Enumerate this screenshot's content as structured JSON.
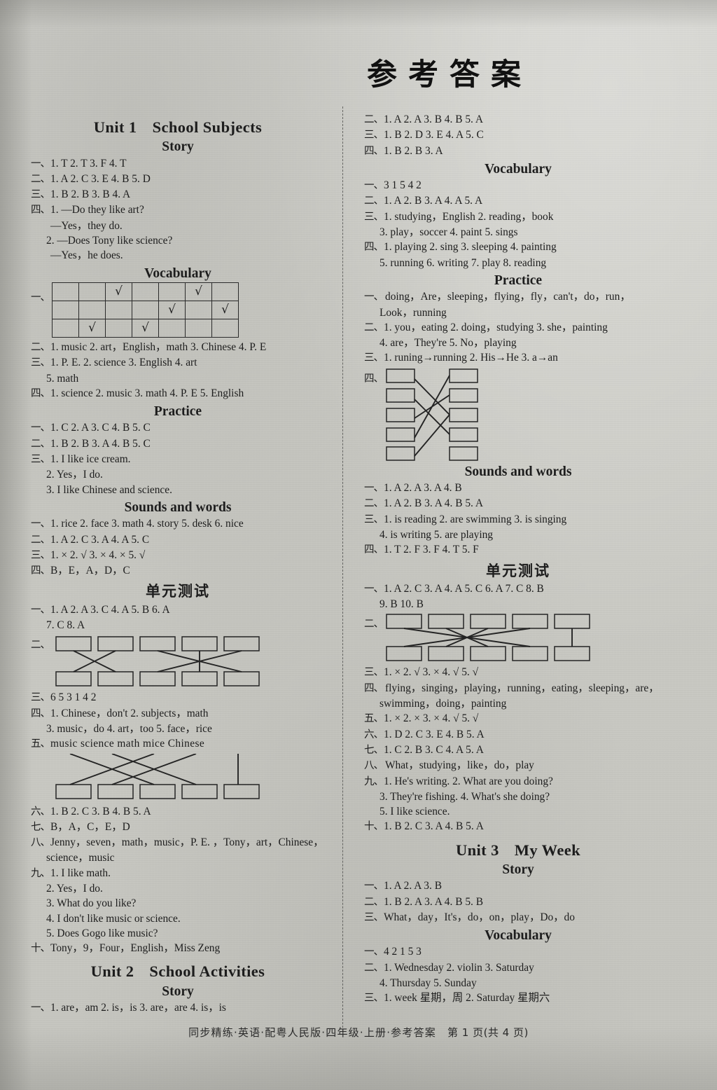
{
  "document": {
    "title": "参考答案",
    "footer": "同步精练·英语·配粤人民版·四年级·上册·参考答案",
    "page_label": "第 1 页(共 4 页)"
  },
  "left_column": {
    "unit1": {
      "number": "Unit 1",
      "name": "School Subjects",
      "story": {
        "heading": "Story",
        "lines": [
          {
            "marker": "一、",
            "text": "1. T  2. T  3. F  4. T"
          },
          {
            "marker": "二、",
            "text": "1. A  2. C  3. E  4. B  5. D"
          },
          {
            "marker": "三、",
            "text": "1. B  2. B  3. B  4. A"
          },
          {
            "marker": "四、",
            "text": "1. —Do they like art?"
          },
          {
            "marker": "",
            "text": "—Yes，they do."
          },
          {
            "marker": "",
            "text": "2. —Does Tony like science?"
          },
          {
            "marker": "",
            "text": "—Yes，he does."
          }
        ]
      },
      "vocabulary": {
        "heading": "Vocabulary",
        "grid_marker": "一、",
        "grid": [
          [
            "",
            "",
            "√",
            "",
            "",
            "√",
            ""
          ],
          [
            "",
            "",
            "",
            "",
            "√",
            "",
            "√"
          ],
          [
            "",
            "√",
            "",
            "√",
            "",
            "",
            ""
          ]
        ],
        "lines": [
          {
            "marker": "二、",
            "text": "1. music  2. art，English，math  3. Chinese  4. P. E"
          },
          {
            "marker": "三、",
            "text": "1. P. E.  2. science  3. English  4. art"
          },
          {
            "marker": "",
            "text": "5. math"
          },
          {
            "marker": "四、",
            "text": "1. science  2. music  3. math  4. P. E  5. English"
          }
        ]
      },
      "practice": {
        "heading": "Practice",
        "lines": [
          {
            "marker": "一、",
            "text": "1. C  2. A  3. C  4. B  5. C"
          },
          {
            "marker": "二、",
            "text": "1. B  2. B  3. A  4. B  5. C"
          },
          {
            "marker": "三、",
            "text": "1. I like ice cream."
          },
          {
            "marker": "",
            "text": "2. Yes，I do."
          },
          {
            "marker": "",
            "text": "3. I like Chinese and science."
          }
        ]
      },
      "sounds": {
        "heading": "Sounds and words",
        "lines": [
          {
            "marker": "一、",
            "text": "1. rice  2. face  3. math  4. story  5. desk  6. nice"
          },
          {
            "marker": "二、",
            "text": "1. A  2. C  3. A  4. A  5. C"
          },
          {
            "marker": "三、",
            "text": "1. ×  2. √  3. ×  4. ×  5. √"
          },
          {
            "marker": "四、",
            "text": "B，E，A，D，C"
          }
        ]
      },
      "unit_test": {
        "heading": "单元测试",
        "lines_before": [
          {
            "marker": "一、",
            "text": "1. A  2. A  3. C  4. A  5. B  6. A"
          },
          {
            "marker": "",
            "text": "7. C  8. A"
          }
        ],
        "match_marker": "二、",
        "lines_mid": [
          {
            "marker": "三、",
            "text": "6 5 3 1 4 2"
          },
          {
            "marker": "四、",
            "text": "1. Chinese，don't  2. subjects，math"
          },
          {
            "marker": "",
            "text": "3. music，do  4. art，too  5. face，rice"
          }
        ],
        "five_marker": "五、",
        "five_words": "music science math mice Chinese",
        "lines_after": [
          {
            "marker": "六、",
            "text": "1. B  2. C  3. B  4. B  5. A"
          },
          {
            "marker": "七、",
            "text": "B，A，C，E，D"
          },
          {
            "marker": "八、",
            "text": "Jenny，seven，math，music，P. E. ，Tony，art，Chinese，"
          },
          {
            "marker": "",
            "text": "science，music"
          },
          {
            "marker": "九、",
            "text": "1. I like math."
          },
          {
            "marker": "",
            "text": "2. Yes，I do."
          },
          {
            "marker": "",
            "text": "3. What do you like?"
          },
          {
            "marker": "",
            "text": "4. I don't like music or science."
          },
          {
            "marker": "",
            "text": "5. Does Gogo like music?"
          },
          {
            "marker": "十、",
            "text": "Tony，9，Four，English，Miss Zeng"
          }
        ]
      }
    },
    "unit2": {
      "number": "Unit 2",
      "name": "School Activities",
      "story": {
        "heading": "Story",
        "lines": [
          {
            "marker": "一、",
            "text": "1. are，am  2. is，is  3. are，are  4. is，is"
          }
        ]
      }
    }
  },
  "right_column": {
    "unit2_story_cont": {
      "lines": [
        {
          "marker": "二、",
          "text": "1. A  2. A  3. B  4. B  5. A"
        },
        {
          "marker": "三、",
          "text": "1. B  2. D  3. E  4. A  5. C"
        },
        {
          "marker": "四、",
          "text": "1. B  2. B  3. A"
        }
      ]
    },
    "unit2_vocabulary": {
      "heading": "Vocabulary",
      "lines": [
        {
          "marker": "一、",
          "text": "3 1 5 4 2"
        },
        {
          "marker": "二、",
          "text": "1. A  2. B  3. A  4. A  5. A"
        },
        {
          "marker": "三、",
          "text": "1. studying，English  2. reading，book"
        },
        {
          "marker": "",
          "text": "3. play，soccer  4. paint  5. sings"
        },
        {
          "marker": "四、",
          "text": "1. playing  2. sing  3. sleeping  4. painting"
        },
        {
          "marker": "",
          "text": "5. running  6. writing  7. play  8. reading"
        }
      ]
    },
    "unit2_practice": {
      "heading": "Practice",
      "lines": [
        {
          "marker": "一、",
          "text": "doing，Are，sleeping，flying，fly，can't，do，run，"
        },
        {
          "marker": "",
          "text": "Look，running"
        },
        {
          "marker": "二、",
          "text": "1. you，eating  2. doing，studying  3. she，painting"
        },
        {
          "marker": "",
          "text": "4. are，They're  5. No，playing"
        },
        {
          "marker": "三、",
          "text": "1. runing→running  2. His→He  3. a→an"
        }
      ],
      "match_marker": "四、"
    },
    "unit2_sounds": {
      "heading": "Sounds and words",
      "lines": [
        {
          "marker": "一、",
          "text": "1. A  2. A  3. A  4. B"
        },
        {
          "marker": "二、",
          "text": "1. A  2. B  3. A  4. B  5. A"
        },
        {
          "marker": "三、",
          "text": "1. is reading  2. are swimming  3. is singing"
        },
        {
          "marker": "",
          "text": "4. is writing  5. are playing"
        },
        {
          "marker": "四、",
          "text": "1. T  2. F  3. F  4. T  5. F"
        }
      ]
    },
    "unit2_test": {
      "heading": "单元测试",
      "lines_before": [
        {
          "marker": "一、",
          "text": "1. A  2. C  3. A  4. A  5. C  6. A  7. C  8. B"
        },
        {
          "marker": "",
          "text": "9. B  10. B"
        }
      ],
      "match_marker": "二、",
      "lines_after": [
        {
          "marker": "三、",
          "text": "1. ×  2. √  3. ×  4. √  5. √"
        },
        {
          "marker": "四、",
          "text": "flying，singing，playing，running，eating，sleeping，are，"
        },
        {
          "marker": "",
          "text": "swimming，doing，painting"
        },
        {
          "marker": "五、",
          "text": "1. ×  2. ×  3. ×  4. √  5. √"
        },
        {
          "marker": "六、",
          "text": "1. D  2. C  3. E  4. B  5. A"
        },
        {
          "marker": "七、",
          "text": "1. C  2. B  3. C  4. A  5. A"
        },
        {
          "marker": "八、",
          "text": "What，studying，like，do，play"
        },
        {
          "marker": "九、",
          "text": "1. He's writing.   2. What are you doing?"
        },
        {
          "marker": "",
          "text": "3. They're fishing.   4. What's she doing?"
        },
        {
          "marker": "",
          "text": "5. I like science."
        },
        {
          "marker": "十、",
          "text": "1. B  2. C  3. A  4. B  5. A"
        }
      ]
    },
    "unit3": {
      "number": "Unit 3",
      "name": "My Week",
      "story": {
        "heading": "Story",
        "lines": [
          {
            "marker": "一、",
            "text": "1. A  2. A  3. B"
          },
          {
            "marker": "二、",
            "text": "1. B  2. A  3. A  4. B  5. B"
          },
          {
            "marker": "三、",
            "text": "What，day，It's，do，on，play，Do，do"
          }
        ]
      },
      "vocabulary": {
        "heading": "Vocabulary",
        "lines": [
          {
            "marker": "一、",
            "text": "4 2 1 5 3"
          },
          {
            "marker": "二、",
            "text": "1. Wednesday  2. violin  3. Saturday"
          },
          {
            "marker": "",
            "text": "4. Thursday  5. Sunday"
          },
          {
            "marker": "三、",
            "text": "1. week 星期，周  2. Saturday 星期六"
          }
        ]
      }
    }
  }
}
